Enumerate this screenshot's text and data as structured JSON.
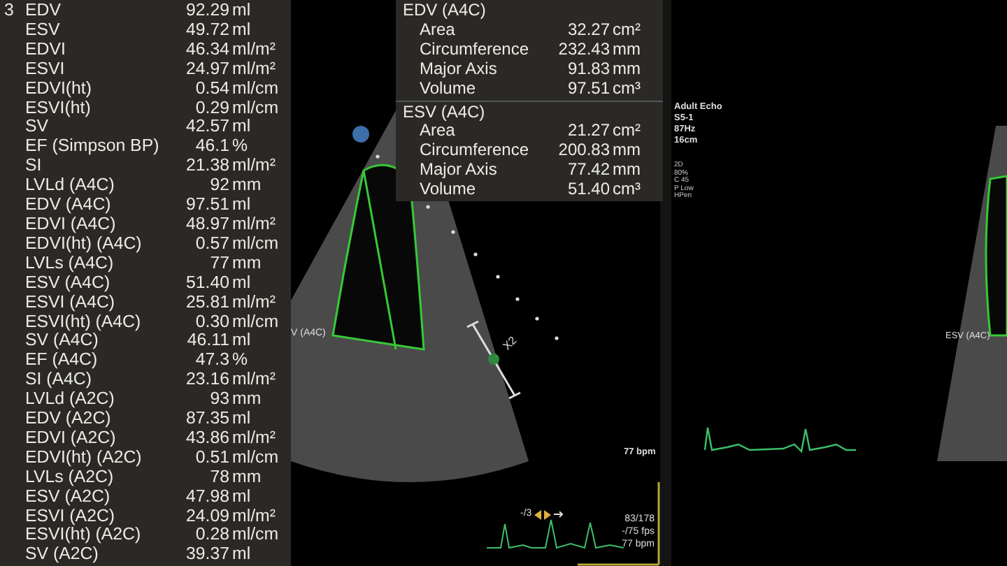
{
  "measurements": {
    "index": "3",
    "rows": [
      {
        "label": "EDV",
        "value": "92.29",
        "unit": "ml"
      },
      {
        "label": "ESV",
        "value": "49.72",
        "unit": "ml"
      },
      {
        "label": "EDVI",
        "value": "46.34",
        "unit": "ml/m²"
      },
      {
        "label": "ESVI",
        "value": "24.97",
        "unit": "ml/m²"
      },
      {
        "label": "EDVI(ht)",
        "value": "0.54",
        "unit": "ml/cm"
      },
      {
        "label": "ESVI(ht)",
        "value": "0.29",
        "unit": "ml/cm"
      },
      {
        "label": "SV",
        "value": "42.57",
        "unit": "ml"
      },
      {
        "label": "EF (Simpson BP)",
        "value": "46.1",
        "unit": "%"
      },
      {
        "label": "SI",
        "value": "21.38",
        "unit": "ml/m²"
      },
      {
        "label": "LVLd (A4C)",
        "value": "92",
        "unit": "mm"
      },
      {
        "label": "EDV (A4C)",
        "value": "97.51",
        "unit": "ml"
      },
      {
        "label": "EDVI (A4C)",
        "value": "48.97",
        "unit": "ml/m²"
      },
      {
        "label": "EDVI(ht) (A4C)",
        "value": "0.57",
        "unit": "ml/cm"
      },
      {
        "label": "LVLs (A4C)",
        "value": "77",
        "unit": "mm"
      },
      {
        "label": "ESV (A4C)",
        "value": "51.40",
        "unit": "ml"
      },
      {
        "label": "ESVI (A4C)",
        "value": "25.81",
        "unit": "ml/m²"
      },
      {
        "label": "ESVI(ht) (A4C)",
        "value": "0.30",
        "unit": "ml/cm"
      },
      {
        "label": "SV (A4C)",
        "value": "46.11",
        "unit": "ml"
      },
      {
        "label": "EF (A4C)",
        "value": "47.3",
        "unit": "%"
      },
      {
        "label": "SI (A4C)",
        "value": "23.16",
        "unit": "ml/m²"
      },
      {
        "label": "LVLd (A2C)",
        "value": "93",
        "unit": "mm"
      },
      {
        "label": "EDV (A2C)",
        "value": "87.35",
        "unit": "ml"
      },
      {
        "label": "EDVI (A2C)",
        "value": "43.86",
        "unit": "ml/m²"
      },
      {
        "label": "EDVI(ht) (A2C)",
        "value": "0.51",
        "unit": "ml/cm"
      },
      {
        "label": "LVLs (A2C)",
        "value": "78",
        "unit": "mm"
      },
      {
        "label": "ESV (A2C)",
        "value": "47.98",
        "unit": "ml"
      },
      {
        "label": "ESVI (A2C)",
        "value": "24.09",
        "unit": "ml/m²"
      },
      {
        "label": "ESVI(ht) (A2C)",
        "value": "0.28",
        "unit": "ml/cm"
      },
      {
        "label": "SV (A2C)",
        "value": "39.37",
        "unit": "ml"
      }
    ]
  },
  "tracing_panel": {
    "groups": [
      {
        "title": "EDV (A4C)",
        "rows": [
          {
            "label": "Area",
            "value": "32.27",
            "unit": "cm²"
          },
          {
            "label": "Circumference",
            "value": "232.43",
            "unit": "mm"
          },
          {
            "label": "Major Axis",
            "value": "91.83",
            "unit": "mm"
          },
          {
            "label": "Volume",
            "value": "97.51",
            "unit": "cm³"
          }
        ]
      },
      {
        "title": "ESV (A4C)",
        "rows": [
          {
            "label": "Area",
            "value": "21.27",
            "unit": "cm²"
          },
          {
            "label": "Circumference",
            "value": "200.83",
            "unit": "mm"
          },
          {
            "label": "Major Axis",
            "value": "77.42",
            "unit": "mm"
          },
          {
            "label": "Volume",
            "value": "51.40",
            "unit": "cm³"
          }
        ]
      }
    ]
  },
  "left_view": {
    "overlay_label": "V (A4C)",
    "caliper_label": "X2",
    "heart_rate": "77 bpm",
    "playback": {
      "frame_step": "-/3",
      "frame": "83/178",
      "fps": "-/75 fps",
      "heart_rate": "77 bpm"
    }
  },
  "right_view": {
    "settings": [
      "Adult Echo",
      "S5-1",
      "87Hz",
      "16cm"
    ],
    "mode_settings": [
      "2D",
      "80%",
      "C 45",
      "P Low",
      "HPen"
    ],
    "overlay_label": "ESV (A4C)"
  }
}
